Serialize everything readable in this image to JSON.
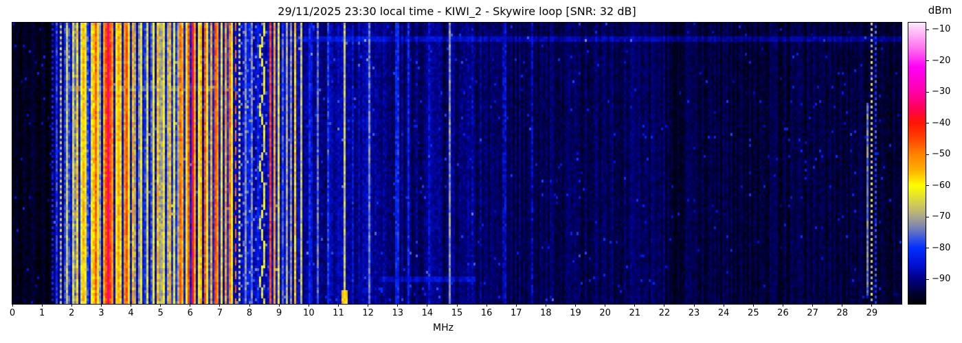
{
  "header": {
    "title": "29/11/2025 23:30 local time - KIWI_2 - Skywire loop [SNR: 32 dB]"
  },
  "chart_data": {
    "type": "heatmap",
    "title": "29/11/2025 23:30 local time - KIWI_2 - Skywire loop [SNR: 32 dB]",
    "xlabel": "MHz",
    "ylabel": "",
    "x_range": [
      0,
      30
    ],
    "x_ticks": [
      0,
      1,
      2,
      3,
      4,
      5,
      6,
      7,
      8,
      9,
      10,
      11,
      12,
      13,
      14,
      15,
      16,
      17,
      18,
      19,
      20,
      21,
      22,
      23,
      24,
      25,
      26,
      27,
      28,
      29
    ],
    "value_range": [
      -97.8,
      -7.8
    ],
    "grid": false,
    "legend_position": "none",
    "colorbar": {
      "label": "dBm",
      "ticks": [
        {
          "v": -10,
          "label": "−10"
        },
        {
          "v": -20,
          "label": "−20"
        },
        {
          "v": -30,
          "label": "−30"
        },
        {
          "v": -40,
          "label": "−40"
        },
        {
          "v": -50,
          "label": "−50"
        },
        {
          "v": -60,
          "label": "−60"
        },
        {
          "v": -70,
          "label": "−70"
        },
        {
          "v": -80,
          "label": "−80"
        },
        {
          "v": -90,
          "label": "−90"
        }
      ]
    },
    "colormap": [
      [
        -98.0,
        "#000000"
      ],
      [
        -95.0,
        "#000028"
      ],
      [
        -90.0,
        "#000085"
      ],
      [
        -85.0,
        "#0012d8"
      ],
      [
        -80.0,
        "#0030ff"
      ],
      [
        -76.0,
        "#4862d8"
      ],
      [
        -73.0,
        "#8287ae"
      ],
      [
        -70.0,
        "#aaa78c"
      ],
      [
        -66.0,
        "#d0cc55"
      ],
      [
        -60.0,
        "#ffff00"
      ],
      [
        -55.0,
        "#ffb000"
      ],
      [
        -50.0,
        "#ff8400"
      ],
      [
        -45.0,
        "#ff4600"
      ],
      [
        -40.0,
        "#ff1800"
      ],
      [
        -35.0,
        "#ff0058"
      ],
      [
        -30.0,
        "#ff00a8"
      ],
      [
        -22.0,
        "#ff00f8"
      ],
      [
        -16.0,
        "#ff70ee"
      ],
      [
        -10.0,
        "#ffc8f8"
      ],
      [
        -8.0,
        "#ffe6fc"
      ]
    ],
    "seed": 20251129,
    "bins": 432,
    "rows": 102,
    "noise_floor_dbm": -95,
    "snr_db": 32,
    "noise_regions": [
      {
        "f0": 0.0,
        "f1": 1.3,
        "base": -96.0,
        "var": 2.2
      },
      {
        "f0": 1.3,
        "f1": 1.75,
        "base": -92.0,
        "var": 3.0
      },
      {
        "f0": 1.75,
        "f1": 7.4,
        "base": -84.0,
        "var": 5.0
      },
      {
        "f0": 7.4,
        "f1": 9.7,
        "base": -86.0,
        "var": 4.5
      },
      {
        "f0": 9.7,
        "f1": 12.3,
        "base": -88.5,
        "var": 3.5
      },
      {
        "f0": 12.3,
        "f1": 16.0,
        "base": -91.0,
        "var": 3.0
      },
      {
        "f0": 16.0,
        "f1": 22.0,
        "base": -92.5,
        "var": 2.6
      },
      {
        "f0": 22.0,
        "f1": 30.0,
        "base": -94.0,
        "var": 2.4
      }
    ],
    "stripes_f_w_level_style": [
      [
        1.35,
        0.03,
        -83,
        "dot0"
      ],
      [
        1.5,
        0.03,
        -80,
        "solid"
      ],
      [
        1.62,
        0.04,
        -79,
        "solid"
      ],
      [
        1.66,
        0.025,
        -67,
        "dot1"
      ],
      [
        1.76,
        0.03,
        -79,
        "solid"
      ],
      [
        1.86,
        0.03,
        -66,
        "solid"
      ],
      [
        1.94,
        0.03,
        -78,
        "solid"
      ],
      [
        2.06,
        0.035,
        -65,
        "solid"
      ],
      [
        2.13,
        0.03,
        -74,
        "solid"
      ],
      [
        2.22,
        0.04,
        -57,
        "solid"
      ],
      [
        2.31,
        0.035,
        -63,
        "solid"
      ],
      [
        2.39,
        0.05,
        -55,
        "solid"
      ],
      [
        2.47,
        0.035,
        -62,
        "solid"
      ],
      [
        2.56,
        0.03,
        -77,
        "solid"
      ],
      [
        2.64,
        0.035,
        -63,
        "solid"
      ],
      [
        2.72,
        0.04,
        -56,
        "solid"
      ],
      [
        2.81,
        0.045,
        -47,
        "solid"
      ],
      [
        2.89,
        0.035,
        -62,
        "solid"
      ],
      [
        2.97,
        0.03,
        -71,
        "solid"
      ],
      [
        3.06,
        0.04,
        -54,
        "solid"
      ],
      [
        3.15,
        0.045,
        -45,
        "solid"
      ],
      [
        3.22,
        0.04,
        -33,
        "solid"
      ],
      [
        3.31,
        0.04,
        -45,
        "solid"
      ],
      [
        3.4,
        0.04,
        -52,
        "solid"
      ],
      [
        3.49,
        0.035,
        -60,
        "solid"
      ],
      [
        3.57,
        0.04,
        -54,
        "solid"
      ],
      [
        3.66,
        0.035,
        -58,
        "solid"
      ],
      [
        3.76,
        0.045,
        -52,
        "solid"
      ],
      [
        3.86,
        0.045,
        -46,
        "solid"
      ],
      [
        3.95,
        0.035,
        -60,
        "solid"
      ],
      [
        4.06,
        0.04,
        -55,
        "solid"
      ],
      [
        4.16,
        0.04,
        -70,
        "solid"
      ],
      [
        4.27,
        0.12,
        -72,
        "solid"
      ],
      [
        4.36,
        0.035,
        -62,
        "solid"
      ],
      [
        4.46,
        0.03,
        -79,
        "solid"
      ],
      [
        4.56,
        0.035,
        -64,
        "solid"
      ],
      [
        4.66,
        0.03,
        -77,
        "solid"
      ],
      [
        4.78,
        0.04,
        -61,
        "solid"
      ],
      [
        4.89,
        0.04,
        -56,
        "solid"
      ],
      [
        5.0,
        0.04,
        -70,
        "solid"
      ],
      [
        5.11,
        0.035,
        -63,
        "solid"
      ],
      [
        5.21,
        0.05,
        -69,
        "solid"
      ],
      [
        5.33,
        0.045,
        -55,
        "solid"
      ],
      [
        5.45,
        0.035,
        -62,
        "solid"
      ],
      [
        5.56,
        0.05,
        -70,
        "solid"
      ],
      [
        5.66,
        0.04,
        -48,
        "solid"
      ],
      [
        5.76,
        0.04,
        -54,
        "solid"
      ],
      [
        5.86,
        0.035,
        -60,
        "solid"
      ],
      [
        5.96,
        0.045,
        -46,
        "solid"
      ],
      [
        6.07,
        0.04,
        -38,
        "solid"
      ],
      [
        6.16,
        0.04,
        -53,
        "solid"
      ],
      [
        6.26,
        0.035,
        -61,
        "solid"
      ],
      [
        6.36,
        0.04,
        -55,
        "solid"
      ],
      [
        6.46,
        0.045,
        -47,
        "solid"
      ],
      [
        6.56,
        0.035,
        -60,
        "solid"
      ],
      [
        6.69,
        0.04,
        -54,
        "solid"
      ],
      [
        6.81,
        0.045,
        -45,
        "solid"
      ],
      [
        6.93,
        0.04,
        -52,
        "solid"
      ],
      [
        7.06,
        0.035,
        -59,
        "solid"
      ],
      [
        7.19,
        0.04,
        -53,
        "solid"
      ],
      [
        7.31,
        0.045,
        -48,
        "solid"
      ],
      [
        7.43,
        0.03,
        -62,
        "solid"
      ],
      [
        7.55,
        0.05,
        -48,
        "dash"
      ],
      [
        7.66,
        0.03,
        -64,
        "dot0"
      ],
      [
        7.86,
        0.03,
        -73,
        "solid"
      ],
      [
        8.06,
        0.03,
        -74,
        "solid"
      ],
      [
        8.46,
        0.05,
        -63,
        "drift",
        0.07
      ],
      [
        8.71,
        0.05,
        -44,
        "solid"
      ],
      [
        8.86,
        0.04,
        -53,
        "solid"
      ],
      [
        9.0,
        0.03,
        -63,
        "solid"
      ],
      [
        9.12,
        0.035,
        -77,
        "solid"
      ],
      [
        9.26,
        0.03,
        -70,
        "solid"
      ],
      [
        9.41,
        0.03,
        -72,
        "solid"
      ],
      [
        9.57,
        0.035,
        -57,
        "solid"
      ],
      [
        9.76,
        0.025,
        -67,
        "solid"
      ],
      [
        10.05,
        0.1,
        -81,
        "fuzzy"
      ],
      [
        10.32,
        0.03,
        -75,
        "solid"
      ],
      [
        10.67,
        0.03,
        -80,
        "solid"
      ],
      [
        11.2,
        0.03,
        -66,
        "solid"
      ],
      [
        11.47,
        0.03,
        -83,
        "dot1"
      ],
      [
        12.08,
        0.03,
        -74,
        "solid"
      ],
      [
        12.99,
        0.1,
        -79,
        "fuzzy"
      ],
      [
        13.37,
        0.03,
        -82,
        "solid"
      ],
      [
        14.03,
        0.03,
        -85,
        "solid"
      ],
      [
        14.75,
        0.03,
        -72,
        "solid"
      ],
      [
        15.52,
        0.03,
        -86,
        "dot0"
      ],
      [
        16.61,
        0.09,
        -83,
        "fuzzy"
      ],
      [
        17.52,
        0.03,
        -87,
        "solid"
      ],
      [
        28.82,
        0.03,
        -74,
        "partial",
        0.28,
        0.97
      ],
      [
        28.98,
        0.04,
        -66,
        "dot0"
      ],
      [
        29.16,
        0.04,
        -78,
        "dot1"
      ]
    ],
    "diag_band": {
      "f0": 7.62,
      "f1": 8.62,
      "period": 11,
      "level": -74
    },
    "row_events": [
      {
        "jf": 0.045,
        "f0": 9.4,
        "f1": 30.0,
        "boost": 5
      },
      {
        "jf": 0.23,
        "f0": 1.8,
        "f1": 7.6,
        "boost": 6
      },
      {
        "jf": 0.9,
        "f0": 12.4,
        "f1": 15.6,
        "boost": 5
      }
    ],
    "bottom_blob": {
      "f0": 11.12,
      "f1": 11.32,
      "jf": 0.95,
      "level": -56
    },
    "speckle": {
      "prob": 0.012,
      "boost_min": 6,
      "boost_max": 14
    }
  }
}
